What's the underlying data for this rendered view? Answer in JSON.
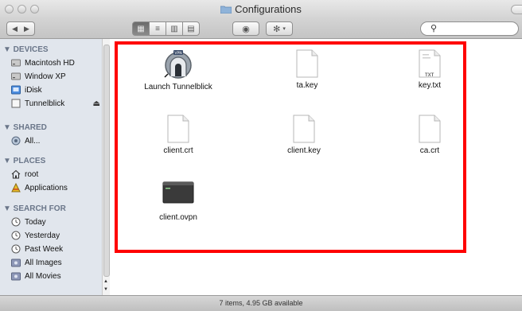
{
  "window": {
    "title": "Configurations"
  },
  "sidebar": {
    "sections": [
      {
        "label": "▼ DEVICES"
      },
      {
        "label": "▼ SHARED"
      },
      {
        "label": "▼ PLACES"
      },
      {
        "label": "▼ SEARCH FOR"
      }
    ],
    "devices": [
      {
        "label": "Macintosh HD",
        "icon": "hard-drive-icon"
      },
      {
        "label": "Window XP",
        "icon": "hard-drive-icon"
      },
      {
        "label": "iDisk",
        "icon": "idisk-icon"
      },
      {
        "label": "Tunnelblick",
        "icon": "disk-image-icon",
        "eject": "⏏"
      }
    ],
    "shared": [
      {
        "label": "All...",
        "icon": "network-icon"
      }
    ],
    "places": [
      {
        "label": "root",
        "icon": "home-icon"
      },
      {
        "label": "Applications",
        "icon": "applications-icon"
      }
    ],
    "search_for": [
      {
        "label": "Today",
        "icon": "clock-icon"
      },
      {
        "label": "Yesterday",
        "icon": "clock-icon"
      },
      {
        "label": "Past Week",
        "icon": "clock-icon"
      },
      {
        "label": "All Images",
        "icon": "smart-folder-icon"
      },
      {
        "label": "All Movies",
        "icon": "smart-folder-icon"
      }
    ]
  },
  "files": [
    {
      "name": "Launch Tunnelblick",
      "icon": "tunnelblick-app-icon"
    },
    {
      "name": "ta.key",
      "icon": "document-icon"
    },
    {
      "name": "key.txt",
      "icon": "text-document-icon",
      "badge": "TXT"
    },
    {
      "name": "client.crt",
      "icon": "document-icon"
    },
    {
      "name": "client.key",
      "icon": "document-icon"
    },
    {
      "name": "ca.crt",
      "icon": "document-icon"
    },
    {
      "name": "client.ovpn",
      "icon": "terminal-document-icon"
    }
  ],
  "statusbar": {
    "text": "7 items, 4.95 GB available"
  },
  "colors": {
    "highlight": "#ff0000",
    "sidebar_bg": "#e1e6ed",
    "section_header": "#6a7689"
  }
}
